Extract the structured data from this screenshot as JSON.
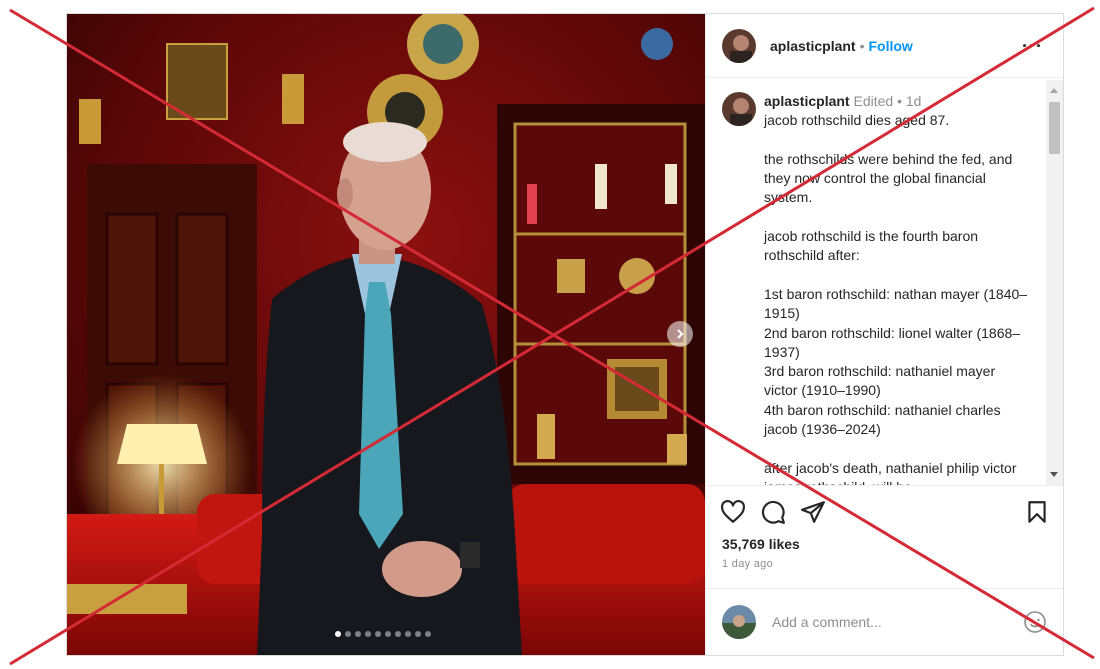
{
  "post": {
    "header": {
      "username": "aplasticplant",
      "separator": "•",
      "follow_label": "Follow",
      "more_label": "···"
    },
    "caption": {
      "username": "aplasticplant",
      "edited_label": "Edited",
      "separator": "•",
      "time": "1d",
      "text": "jacob rothschild dies aged 87.\n\nthe rothschilds were behind the fed, and they now control the global financial system.\n\njacob rothschild is the fourth baron rothschild after:\n\n1st baron rothschild: nathan mayer (1840–1915)\n2nd baron rothschild: lionel walter (1868–1937)\n3rd baron rothschild: nathaniel mayer victor (1910–1990)\n4th baron rothschild: nathaniel charles jacob (1936–2024)\n\nafter jacob's death, nathaniel philip victor james rothschild, will be"
    },
    "actions": {
      "like_icon": "heart-icon",
      "comment_icon": "comment-icon",
      "share_icon": "paper-plane-icon",
      "save_icon": "bookmark-icon"
    },
    "likes": "35,769 likes",
    "timestamp": "1 day ago",
    "comment": {
      "placeholder": "Add a comment...",
      "emoji_icon": "smiley-icon"
    },
    "carousel": {
      "count": 10,
      "active_index": 0,
      "next_icon": "chevron-right-icon"
    },
    "overlay": {
      "mark": "red-x-cross",
      "color": "#d42a35"
    },
    "colors": {
      "follow": "#0095f6",
      "text": "#262626",
      "muted": "#8e8e8e"
    }
  }
}
